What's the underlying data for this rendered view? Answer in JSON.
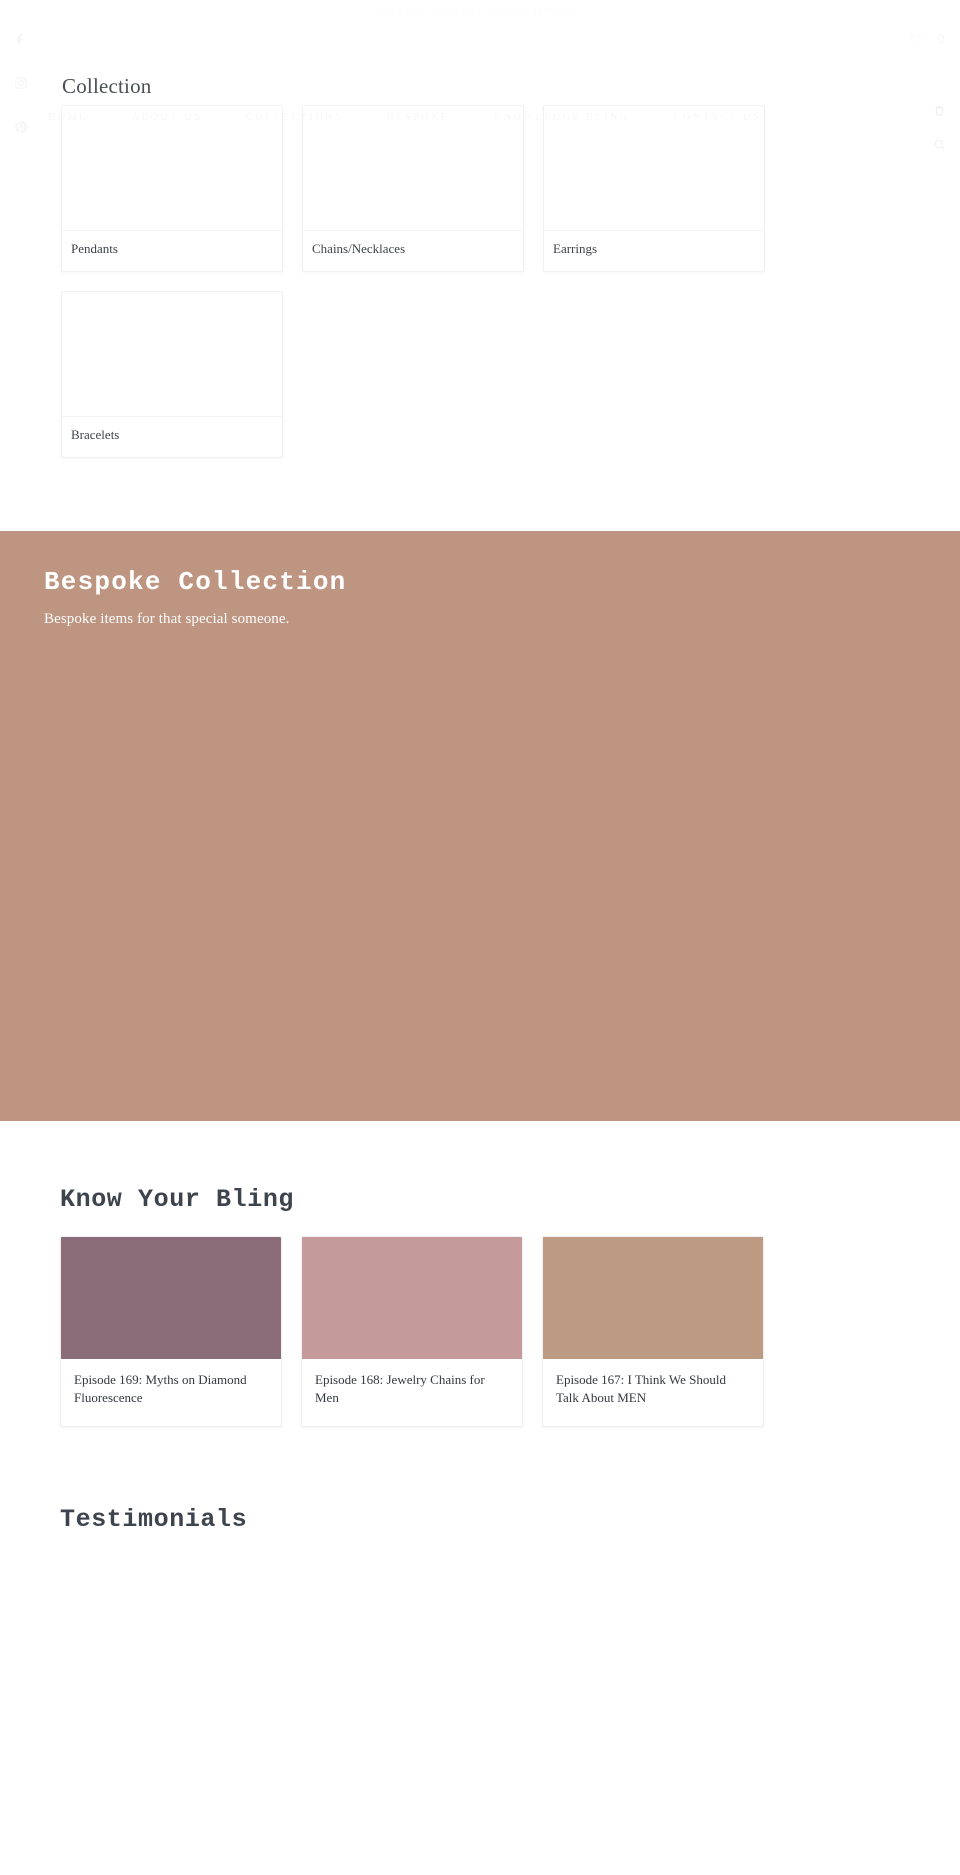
{
  "announcement": {
    "text": "FREE SHIPPING WORLDWIDE"
  },
  "utility": {
    "language": "EN",
    "cart_icon": "cart-icon"
  },
  "social": [
    {
      "name": "facebook-icon"
    },
    {
      "name": "instagram-icon"
    },
    {
      "name": "pinterest-icon"
    }
  ],
  "nav": {
    "items": [
      {
        "label": "HOME"
      },
      {
        "label": "ABOUT US"
      },
      {
        "label": "COLLECTIONS"
      },
      {
        "label": "BESPOKE"
      },
      {
        "label": "KNOWLEDGE BLING"
      },
      {
        "label": "CONTACT US"
      }
    ],
    "cart_icon": "bag-icon",
    "search_icon": "search-icon"
  },
  "collection": {
    "title": "Collection",
    "cards": [
      {
        "label": "Pendants"
      },
      {
        "label": "Chains/Necklaces"
      },
      {
        "label": "Earrings"
      },
      {
        "label": "Bracelets"
      }
    ]
  },
  "bespoke": {
    "title": "Bespoke Collection",
    "subtitle": "Bespoke items for that special someone.",
    "background": "#bd9580"
  },
  "bling": {
    "title": "Know Your Bling",
    "episodes": [
      {
        "title": "Episode 169: Myths on Diamond Fluorescence",
        "color": "#8b6d79"
      },
      {
        "title": "Episode 168: Jewelry Chains for Men",
        "color": "#c49a9a"
      },
      {
        "title": "Episode 167: I Think We Should Talk About MEN",
        "color": "#bd9a82"
      }
    ]
  },
  "testimonials": {
    "title": "Testimonials"
  }
}
